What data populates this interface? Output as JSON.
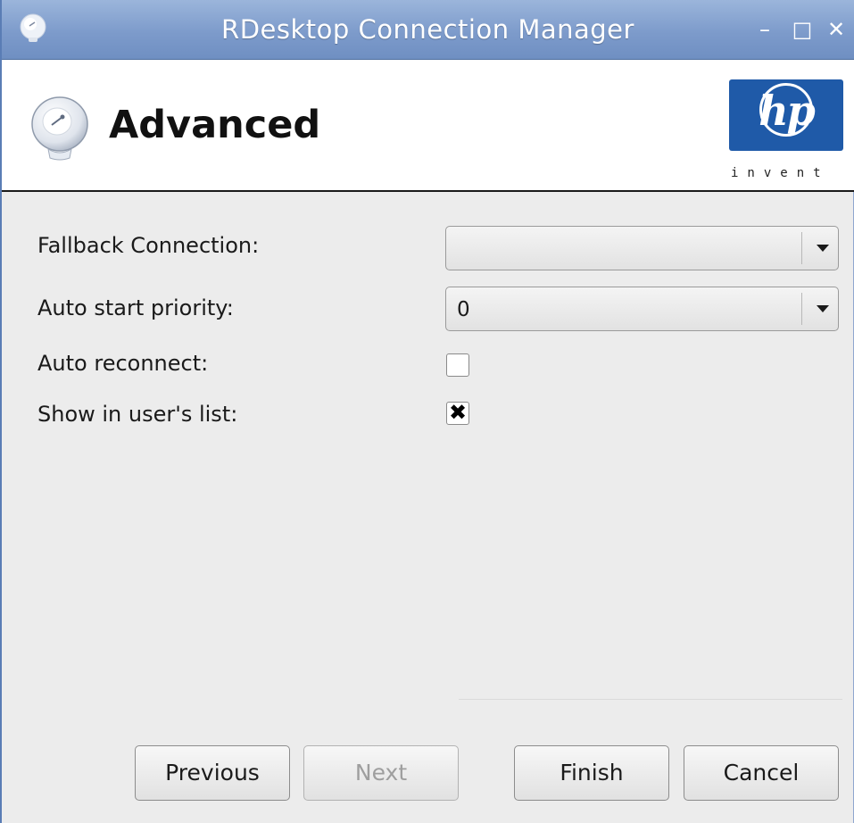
{
  "window": {
    "title": "RDesktop Connection Manager",
    "minimize_symbol": "–",
    "maximize_symbol": "□",
    "close_symbol": "✕"
  },
  "header": {
    "title": "Advanced",
    "icon": "dish-icon",
    "logo": {
      "mark": "hp",
      "tagline": "invent",
      "color": "#1f5aa8"
    }
  },
  "form": {
    "fallback_connection": {
      "label": "Fallback Connection:",
      "value": ""
    },
    "auto_start_priority": {
      "label": "Auto start priority:",
      "value": "0"
    },
    "auto_reconnect": {
      "label": "Auto reconnect:",
      "checked": false
    },
    "show_in_user_list": {
      "label": "Show in user's list:",
      "checked": true,
      "mark": "✖"
    }
  },
  "buttons": {
    "previous": "Previous",
    "next": "Next",
    "finish": "Finish",
    "cancel": "Cancel"
  },
  "colors": {
    "titlebar": "#7d9bcb",
    "background": "#ececec",
    "disabled_text": "#9e9e9e"
  }
}
